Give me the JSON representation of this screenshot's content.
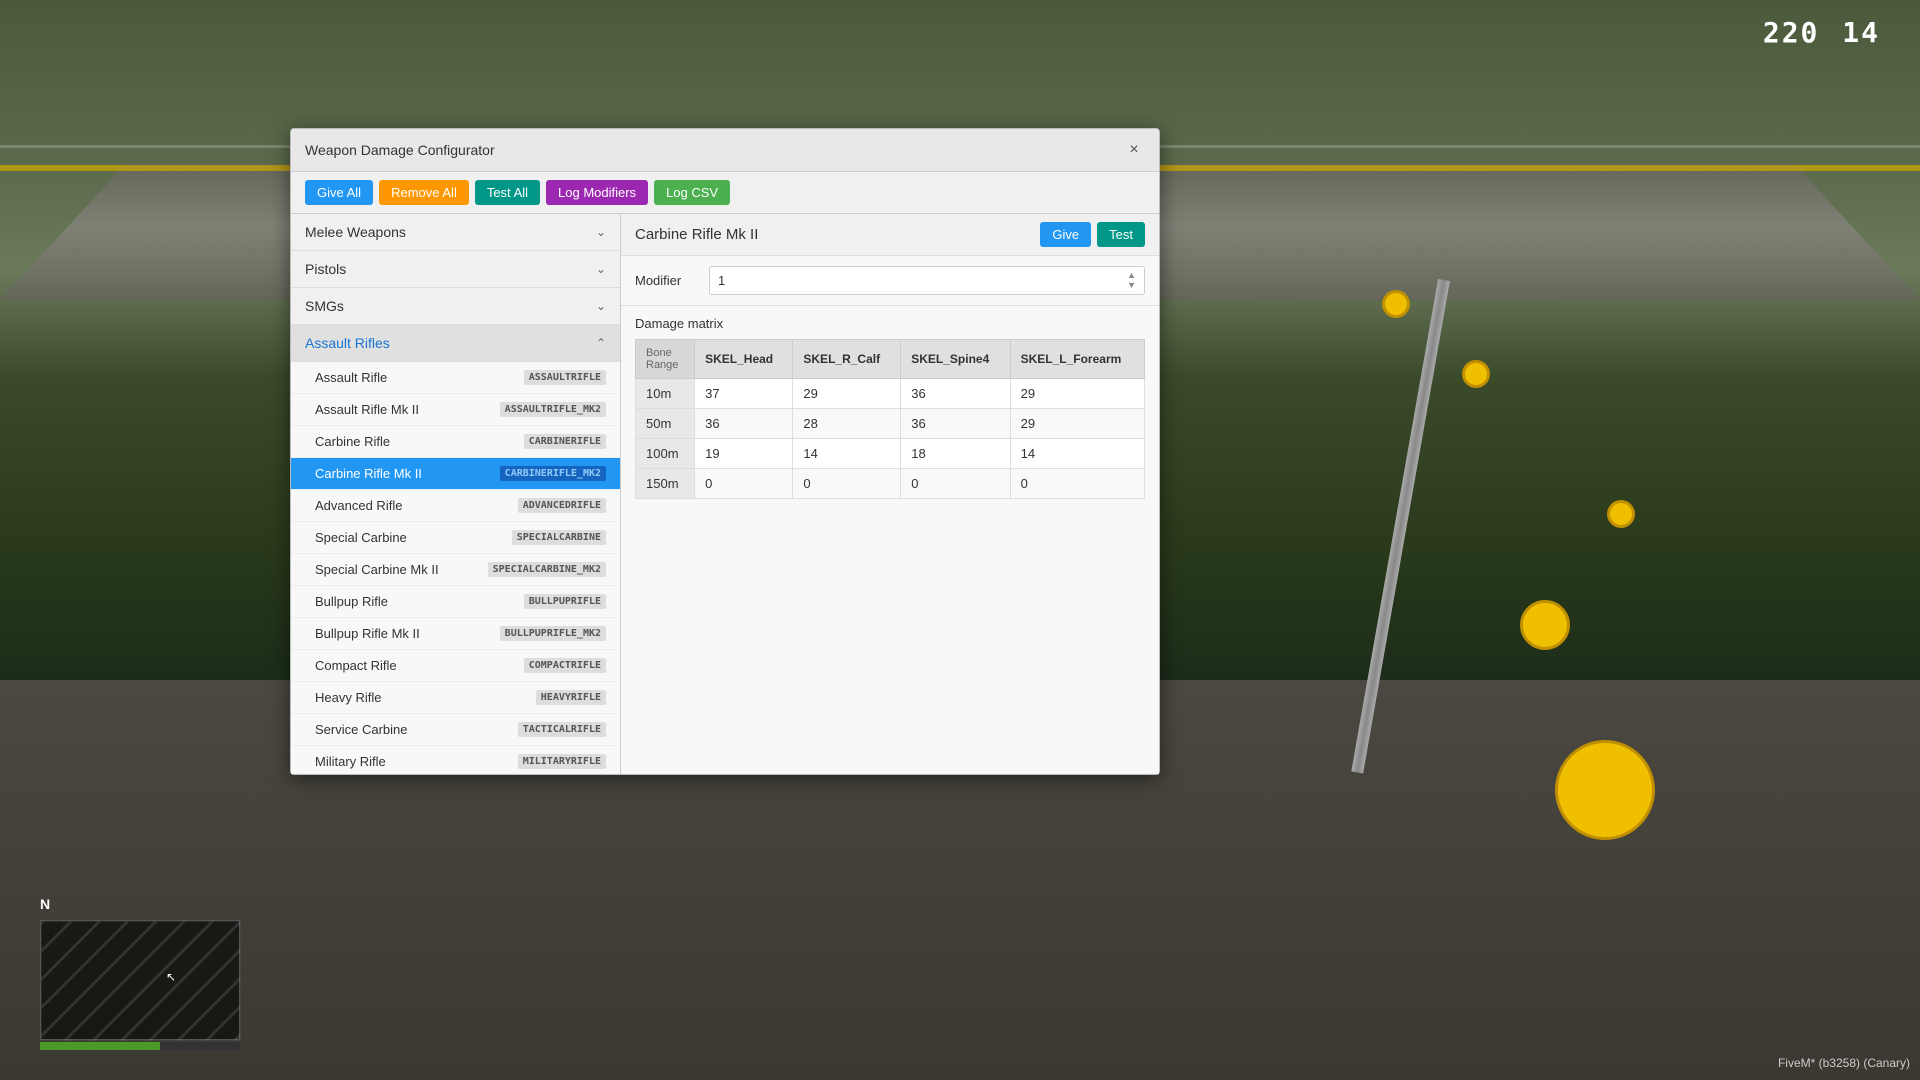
{
  "hud": {
    "timer": "220",
    "timer_separator": "14",
    "fivem_info": "FiveM* (b3258) (Canary)"
  },
  "dialog": {
    "title": "Weapon Damage Configurator",
    "close_label": "×",
    "toolbar": {
      "give_all": "Give All",
      "remove_all": "Remove All",
      "test_all": "Test All",
      "log_modifiers": "Log Modifiers",
      "log_csv": "Log CSV"
    },
    "selected_weapon": "Carbine Rifle Mk II",
    "give_label": "Give",
    "test_label": "Test",
    "modifier_label": "Modifier",
    "modifier_value": "1",
    "damage_matrix_title": "Damage matrix",
    "columns": {
      "bone": "Bone",
      "range": "Range",
      "skel_head": "SKEL_Head",
      "skel_r_calf": "SKEL_R_Calf",
      "skel_spine4": "SKEL_Spine4",
      "skel_l_forearm": "SKEL_L_Forearm"
    },
    "rows": [
      {
        "range": "10m",
        "head": "37",
        "r_calf": "29",
        "spine4": "36",
        "l_forearm": "29"
      },
      {
        "range": "50m",
        "head": "36",
        "r_calf": "28",
        "spine4": "36",
        "l_forearm": "29"
      },
      {
        "range": "100m",
        "head": "19",
        "r_calf": "14",
        "spine4": "18",
        "l_forearm": "14"
      },
      {
        "range": "150m",
        "head": "0",
        "r_calf": "0",
        "spine4": "0",
        "l_forearm": "0"
      }
    ],
    "categories": [
      {
        "id": "melee",
        "label": "Melee Weapons",
        "expanded": false
      },
      {
        "id": "pistols",
        "label": "Pistols",
        "expanded": false
      },
      {
        "id": "smgs",
        "label": "SMGs",
        "expanded": false
      },
      {
        "id": "assault",
        "label": "Assault Rifles",
        "expanded": true
      }
    ],
    "weapons": [
      {
        "name": "Assault Rifle",
        "tag": "ASSAULTRIFLE"
      },
      {
        "name": "Assault Rifle Mk II",
        "tag": "ASSAULTRIFLE_MK2"
      },
      {
        "name": "Carbine Rifle",
        "tag": "CARBINERIFLE"
      },
      {
        "name": "Carbine Rifle Mk II",
        "tag": "CARBINERIFLE_MK2",
        "selected": true
      },
      {
        "name": "Advanced Rifle",
        "tag": "ADVANCEDRIFLE"
      },
      {
        "name": "Special Carbine",
        "tag": "SPECIALCARBINE"
      },
      {
        "name": "Special Carbine Mk II",
        "tag": "SPECIALCARBINE_MK2"
      },
      {
        "name": "Bullpup Rifle",
        "tag": "BULLPUPRIFLE"
      },
      {
        "name": "Bullpup Rifle Mk II",
        "tag": "BULLPUPRIFLE_MK2"
      },
      {
        "name": "Compact Rifle",
        "tag": "COMPACTRIFLE"
      },
      {
        "name": "Heavy Rifle",
        "tag": "HEAVYRIFLE"
      },
      {
        "name": "Service Carbine",
        "tag": "TACTICALRIFLE"
      },
      {
        "name": "Military Rifle",
        "tag": "MILITARYRIFLE"
      }
    ]
  }
}
